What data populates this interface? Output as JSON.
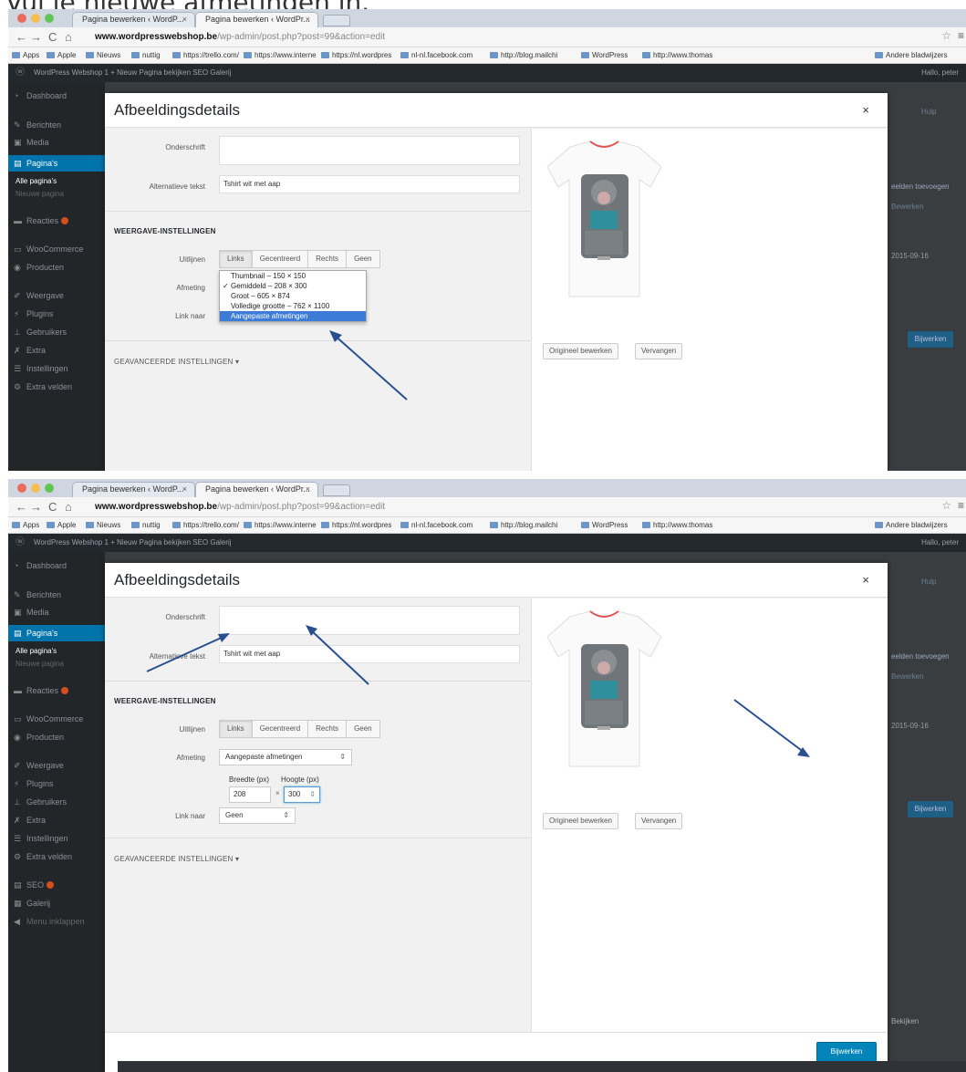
{
  "caption": "Vul je nieuwe afmetingen in.",
  "browser": {
    "tab1": "Pagina bewerken ‹ WordP...",
    "tab2": "Pagina bewerken ‹ WordPr...",
    "tab_close": "×",
    "url_domain": "www.wordpresswebshop.be",
    "url_path": "/wp-admin/post.php?post=99&action=edit",
    "bookmarks": [
      "Apps",
      "Apple",
      "Nieuws",
      "nuttig",
      "https://trello.com/",
      "https://www.interne",
      "https://nl.wordpres",
      "nl-nl.facebook.com",
      "http://blog.mailchi",
      "WordPress",
      "http://www.thomas",
      "Andere bladwijzers"
    ]
  },
  "admin_bar": {
    "items": "WordPress Webshop   1   + Nieuw   Pagina bekijken   SEO   Galerij",
    "howdy": "Hallo, peter"
  },
  "sidebar": {
    "dashboard": "Dashboard",
    "berichten": "Berichten",
    "media": "Media",
    "paginas": "Pagina's",
    "alle_paginas": "Alle pagina's",
    "nieuwe_pagina": "Nieuwe pagina",
    "reacties": "Reacties",
    "woocommerce": "WooCommerce",
    "producten": "Producten",
    "weergave": "Weergave",
    "plugins": "Plugins",
    "gebruikers": "Gebruikers",
    "extra": "Extra",
    "instellingen": "Instellingen",
    "extra_velden": "Extra velden",
    "seo": "SEO",
    "galerij": "Galerij",
    "menu_inklappen": "Menu inklappen"
  },
  "behind": {
    "hulp": "Hulp",
    "beelden": "eelden toevoegen",
    "bewerken_link": "Bewerken",
    "datum": "2015-09-16",
    "bijwerken": "Bijwerken",
    "bekijken": "Bekijken"
  },
  "modal": {
    "title": "Afbeeldingsdetails",
    "close": "×",
    "onderschrift_label": "Onderschrift",
    "alt_label": "Alternatieve tekst",
    "alt_value": "Tshirt wit met aap",
    "display_settings": "WEERGAVE-INSTELLINGEN",
    "uitlijnen_label": "Uitlijnen",
    "align_options": [
      "Links",
      "Gecentreerd",
      "Rechts",
      "Geen"
    ],
    "afmeting_label": "Afmeting",
    "size_options": [
      "Thumbnail – 150 × 150",
      "Gemiddeld – 208 × 300",
      "Groot – 605 × 874",
      "Volledige grootte – 762 × 1100",
      "Aangepaste afmetingen"
    ],
    "size_selected": "Aangepaste afmetingen",
    "link_naar_label": "Link naar",
    "link_naar_value": "Geen",
    "breedte_label": "Breedte (px)",
    "hoogte_label": "Hoogte (px)",
    "breedte_value": "208",
    "hoogte_value": "300",
    "times": "×",
    "advanced": "GEAVANCEERDE INSTELLINGEN",
    "edit_original": "Origineel bewerken",
    "replace": "Vervangen",
    "update": "Bijwerken"
  },
  "accent_color": "#0073aa",
  "annotation_color": "#2a4f8f"
}
